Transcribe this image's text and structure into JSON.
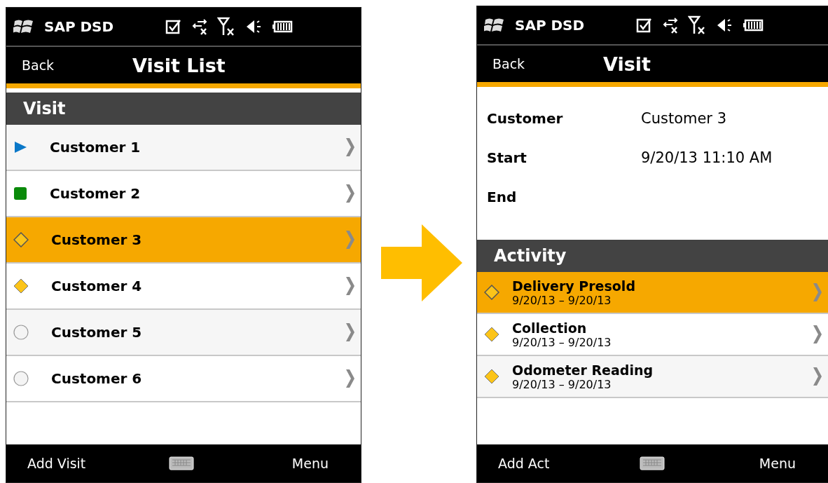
{
  "visit_list_screen": {
    "status_bar": {
      "app_name": "SAP DSD"
    },
    "title_bar": {
      "back": "Back",
      "title": "Visit List"
    },
    "section": {
      "title": "Visit"
    },
    "rows": [
      {
        "label": "Customer 1",
        "kind": "triangle",
        "selected": false
      },
      {
        "label": "Customer 2",
        "kind": "square",
        "selected": false
      },
      {
        "label": "Customer 3",
        "kind": "hollow",
        "selected": true
      },
      {
        "label": "Customer 4",
        "kind": "diamond",
        "selected": false
      },
      {
        "label": "Customer 5",
        "kind": "circle",
        "selected": false
      },
      {
        "label": "Customer 6",
        "kind": "circle",
        "selected": false
      }
    ],
    "bottom_bar": {
      "left": "Add Visit",
      "right": "Menu"
    }
  },
  "visit_screen": {
    "status_bar": {
      "app_name": "SAP DSD"
    },
    "title_bar": {
      "back": "Back",
      "title": "Visit"
    },
    "details": [
      {
        "label": "Customer",
        "value": "Customer 3"
      },
      {
        "label": "Start",
        "value": "9/20/13  11:10 AM"
      },
      {
        "label": "End"
      }
    ],
    "section": {
      "title": "Activity"
    },
    "activities": [
      {
        "title": "Delivery Presold",
        "dates": "9/20/13 – 9/20/13",
        "kind": "hollow",
        "selected": true
      },
      {
        "title": "Collection",
        "dates": "9/20/13 – 9/20/13",
        "kind": "diamond",
        "selected": false
      },
      {
        "title": "Odometer Reading",
        "dates": "9/20/13 – 9/20/13",
        "kind": "diamond",
        "selected": false
      }
    ],
    "bottom_bar": {
      "left": "Add Act",
      "right": "Menu"
    }
  }
}
